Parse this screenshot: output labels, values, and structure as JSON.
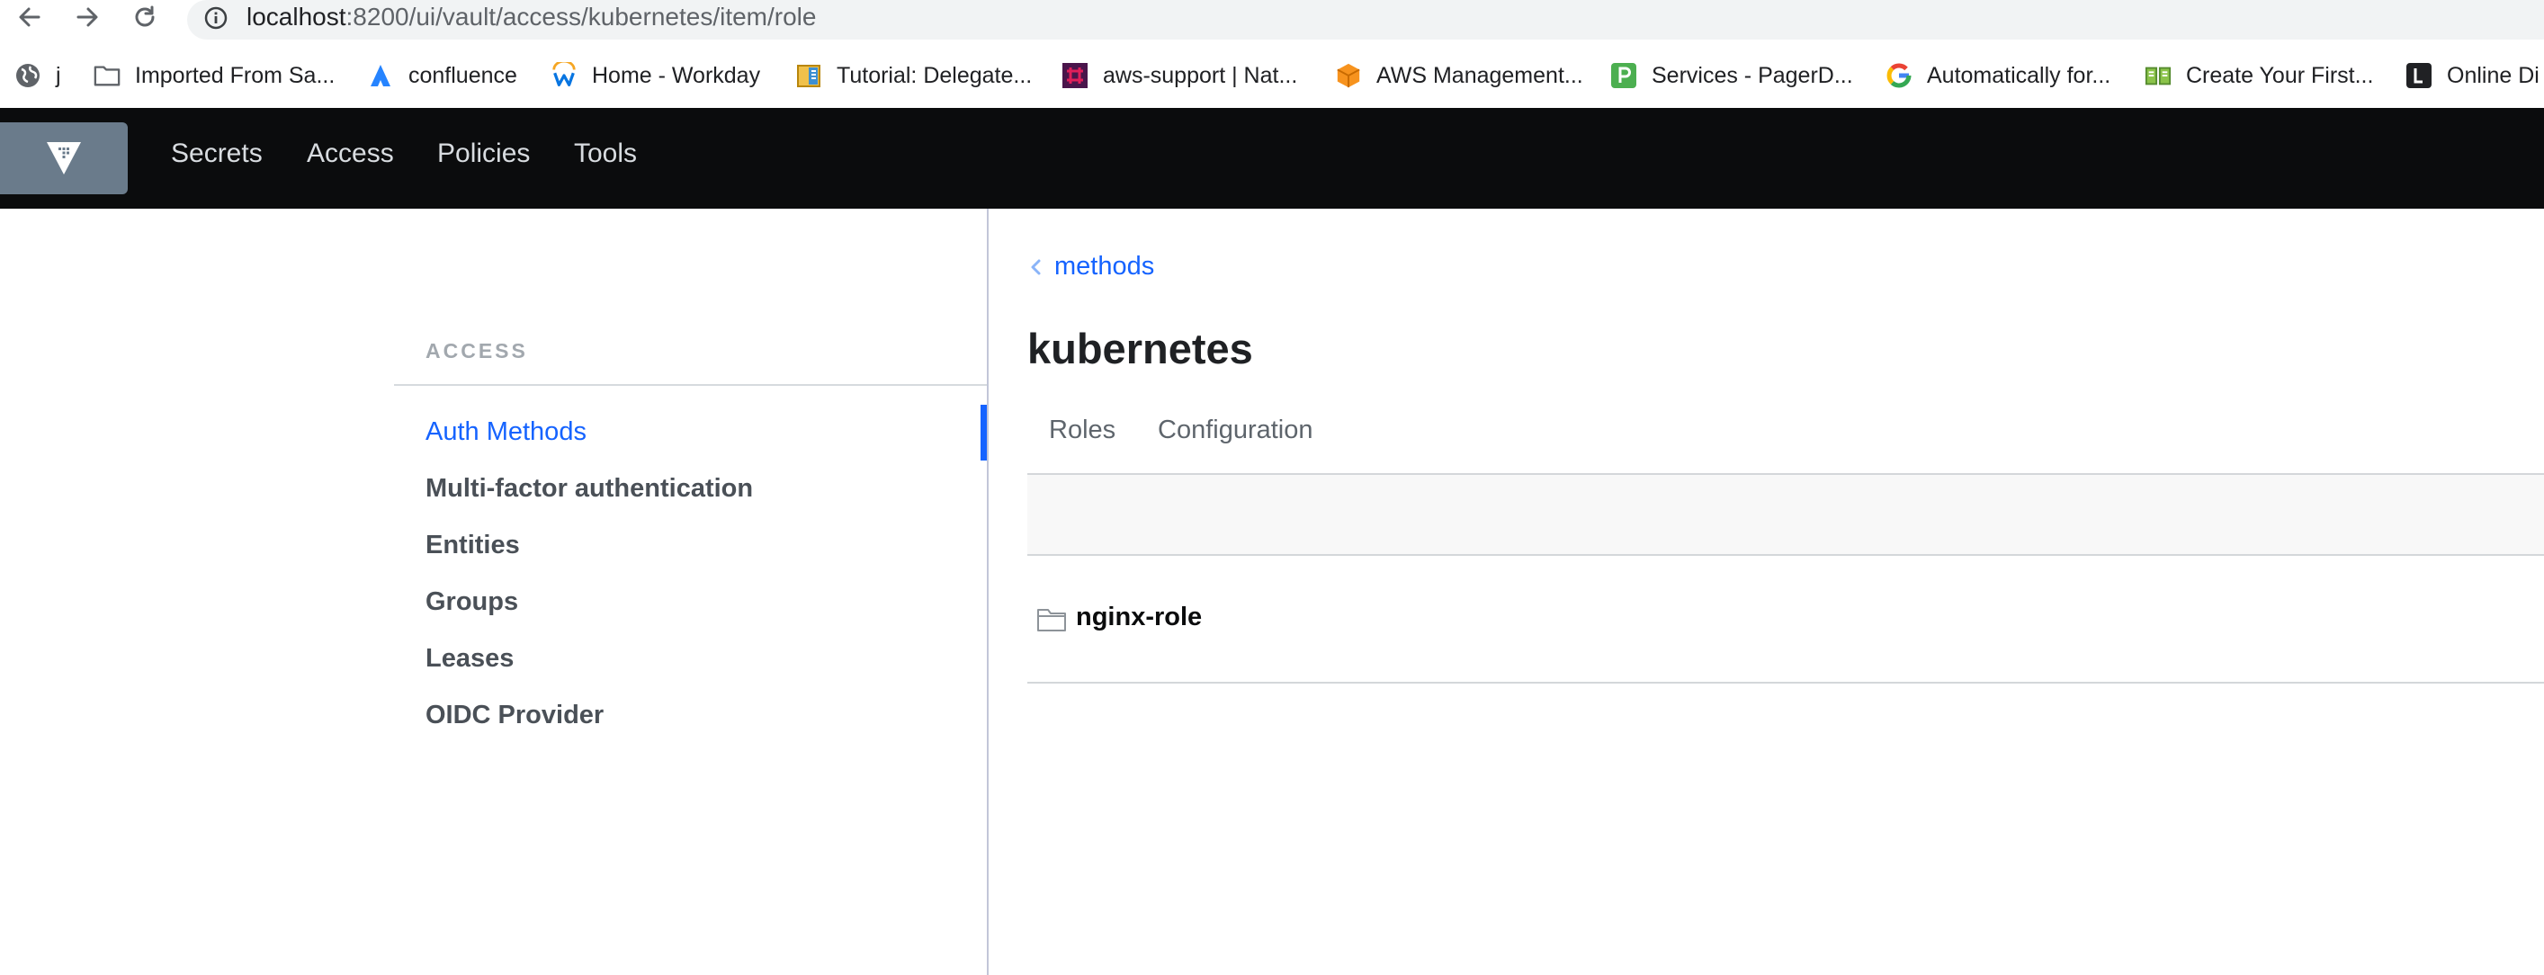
{
  "browser": {
    "url_host": "localhost",
    "url_path": ":8200/ui/vault/access/kubernetes/item/role"
  },
  "bookmarks": [
    {
      "label": "j",
      "icon": "globe-icon"
    },
    {
      "label": "Imported From Sa...",
      "icon": "folder-icon"
    },
    {
      "label": "confluence",
      "icon": "confluence-icon"
    },
    {
      "label": "Home - Workday",
      "icon": "workday-icon"
    },
    {
      "label": "Tutorial: Delegate...",
      "icon": "book-icon"
    },
    {
      "label": "aws-support | Nat...",
      "icon": "slack-icon"
    },
    {
      "label": "AWS Management...",
      "icon": "aws-cube-icon"
    },
    {
      "label": "Services - PagerD...",
      "icon": "pagerduty-icon"
    },
    {
      "label": "Automatically for...",
      "icon": "google-icon"
    },
    {
      "label": "Create Your First...",
      "icon": "open-book-icon"
    },
    {
      "label": "Online Di",
      "icon": "lastpass-icon"
    }
  ],
  "header": {
    "nav": [
      "Secrets",
      "Access",
      "Policies",
      "Tools"
    ]
  },
  "sidebar": {
    "heading": "ACCESS",
    "items": [
      {
        "label": "Auth Methods",
        "active": true
      },
      {
        "label": "Multi-factor authentication"
      },
      {
        "label": "Entities"
      },
      {
        "label": "Groups"
      },
      {
        "label": "Leases"
      },
      {
        "label": "OIDC Provider"
      }
    ]
  },
  "main": {
    "breadcrumb": "methods",
    "title": "kubernetes",
    "tabs": [
      "Roles",
      "Configuration"
    ],
    "items": [
      {
        "label": "nginx-role",
        "icon": "folder-icon"
      }
    ]
  },
  "colors": {
    "accent": "#1563ff",
    "header_bg": "#0b0c0d",
    "logo_bg": "#6a7b8b"
  }
}
